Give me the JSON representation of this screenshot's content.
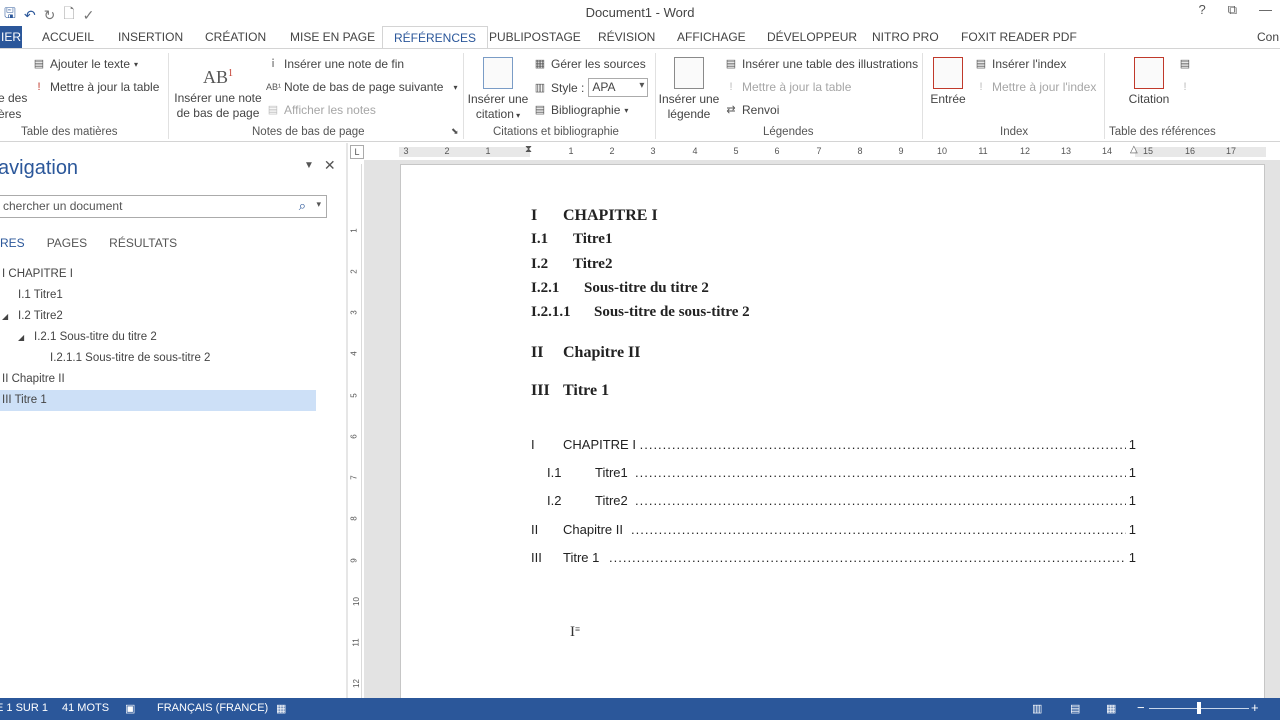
{
  "window": {
    "title": "Document1 - Word",
    "controls": [
      "?",
      "⧉",
      "—"
    ]
  },
  "qat": {
    "icons": [
      "save-icon",
      "undo-icon",
      "redo-icon",
      "new-doc-icon",
      "spelling-icon"
    ]
  },
  "tabs": [
    {
      "label": "IER"
    },
    {
      "label": "ACCUEIL"
    },
    {
      "label": "INSERTION"
    },
    {
      "label": "CRÉATION"
    },
    {
      "label": "MISE EN PAGE"
    },
    {
      "label": "RÉFÉRENCES"
    },
    {
      "label": "PUBLIPOSTAGE"
    },
    {
      "label": "RÉVISION"
    },
    {
      "label": "AFFICHAGE"
    },
    {
      "label": "DÉVELOPPEUR"
    },
    {
      "label": "NITRO PRO"
    },
    {
      "label": "FOXIT READER PDF"
    },
    {
      "label": "Con"
    }
  ],
  "ribbon": {
    "toc": {
      "partial1": "e des",
      "partial2": "ères",
      "add_text": "Ajouter le texte",
      "update_table": "Mettre à jour la table",
      "label": "Table des matières"
    },
    "footnotes": {
      "insert_footnote_line1": "Insérer une note",
      "insert_footnote_line2": "de bas de page",
      "endnote": "Insérer une note de fin",
      "next_footnote": "Note de bas de page suivante",
      "show_notes": "Afficher les notes",
      "label": "Notes de bas de page"
    },
    "citations": {
      "insert_citation_line1": "Insérer une",
      "insert_citation_line2": "citation",
      "manage_sources": "Gérer les sources",
      "style_label": "Style :",
      "style_value": "APA",
      "bibliography": "Bibliographie",
      "label": "Citations et bibliographie"
    },
    "captions": {
      "insert_caption_line1": "Insérer une",
      "insert_caption_line2": "légende",
      "insert_table_figures": "Insérer une table des illustrations",
      "update_table": "Mettre à jour la table",
      "cross_ref": "Renvoi",
      "label": "Légendes"
    },
    "index": {
      "mark_entry": "Entrée",
      "insert_index": "Insérer l'index",
      "update_index": "Mettre à jour l'index",
      "label": "Index"
    },
    "authorities": {
      "mark_citation": "Citation",
      "label": "Table des références"
    }
  },
  "nav": {
    "title": "avigation",
    "search_placeholder": "chercher un document",
    "tabs": [
      "RES",
      "PAGES",
      "RÉSULTATS"
    ],
    "items": [
      {
        "label": "I CHAPITRE I"
      },
      {
        "label": "I.1 Titre1"
      },
      {
        "label": "I.2 Titre2"
      },
      {
        "label": "I.2.1 Sous-titre du titre 2"
      },
      {
        "label": "I.2.1.1 Sous-titre de sous-titre 2"
      },
      {
        "label": "II Chapitre II"
      },
      {
        "label": "III Titre 1"
      }
    ]
  },
  "ruler": {
    "h_numbers": [
      "3",
      "2",
      "1",
      "1",
      "2",
      "3",
      "4",
      "5",
      "6",
      "7",
      "8",
      "9",
      "10",
      "11",
      "12",
      "13",
      "14",
      "15",
      "16",
      "17"
    ],
    "v_numbers": [
      "1",
      "2",
      "3",
      "4",
      "5",
      "6",
      "7",
      "8",
      "9",
      "10",
      "11",
      "12"
    ]
  },
  "document": {
    "headings": [
      {
        "num": "I",
        "text": "CHAPITRE I"
      },
      {
        "num": "I.1",
        "text": "Titre1"
      },
      {
        "num": "I.2",
        "text": "Titre2"
      },
      {
        "num": "I.2.1",
        "text": "Sous-titre du titre 2"
      },
      {
        "num": "I.2.1.1",
        "text": "Sous-titre de sous-titre 2"
      },
      {
        "num": "II",
        "text": "Chapitre II"
      },
      {
        "num": "III",
        "text": "Titre 1"
      }
    ],
    "toc": [
      {
        "num": "I",
        "text": "CHAPITRE I",
        "page": "1"
      },
      {
        "num": "I.1",
        "text": "Titre1",
        "page": "1"
      },
      {
        "num": "I.2",
        "text": "Titre2",
        "page": "1"
      },
      {
        "num": "II",
        "text": "Chapitre II",
        "page": "1"
      },
      {
        "num": "III",
        "text": "Titre 1",
        "page": "1"
      }
    ]
  },
  "status": {
    "page": "E 1 SUR 1",
    "words": "41 MOTS",
    "language": "FRANÇAIS (FRANCE)"
  }
}
